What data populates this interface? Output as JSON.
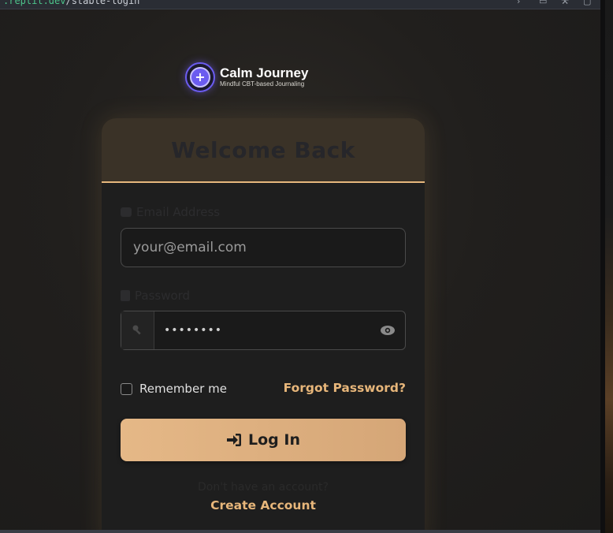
{
  "browser": {
    "url_host": ".replit.dev",
    "url_path": "/stable-login"
  },
  "brand": {
    "name": "Calm Journey",
    "tagline": "Mindful CBT-based Journaling",
    "logo_icon": "plus-circle-icon"
  },
  "card": {
    "title": "Welcome Back"
  },
  "email": {
    "label": "Email Address",
    "placeholder": "your@email.com",
    "value": ""
  },
  "password": {
    "label": "Password",
    "value": "••••••••"
  },
  "remember": {
    "label": "Remember me",
    "checked": false
  },
  "links": {
    "forgot": "Forgot Password?",
    "no_account": "Don't have an account?",
    "create": "Create Account"
  },
  "buttons": {
    "login": "Log In"
  },
  "colors": {
    "accent": "#e7b67a",
    "button_gradient_start": "#e5b887",
    "button_gradient_end": "#d5a677",
    "logo_purple": "#6b5cf0"
  }
}
